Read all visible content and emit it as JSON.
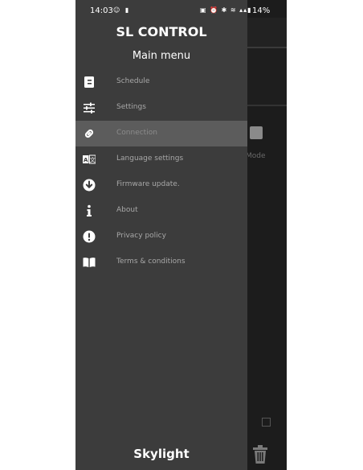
{
  "status_bar": {
    "time": "14:03",
    "battery": "14%"
  },
  "drawer": {
    "title": "SL CONTROL",
    "subtitle": "Main menu",
    "footer": "Skylight",
    "items": [
      {
        "label": "Schedule",
        "icon": "calendar-icon"
      },
      {
        "label": "Settings",
        "icon": "sliders-icon"
      },
      {
        "label": "Connection",
        "icon": "link-icon",
        "active": true
      },
      {
        "label": "Language settings",
        "icon": "translate-icon"
      },
      {
        "label": "Firmware update.",
        "icon": "download-icon"
      },
      {
        "label": "About",
        "icon": "info-icon"
      },
      {
        "label": "Privacy policy",
        "icon": "alert-icon"
      },
      {
        "label": "Terms & conditions",
        "icon": "book-icon"
      }
    ]
  },
  "background_app": {
    "mode_label": "Mode"
  },
  "colors": {
    "drawer_bg": "#3c3c3c",
    "active_item_bg": "#5c5c5c",
    "app_bg": "#1c1c1c"
  }
}
